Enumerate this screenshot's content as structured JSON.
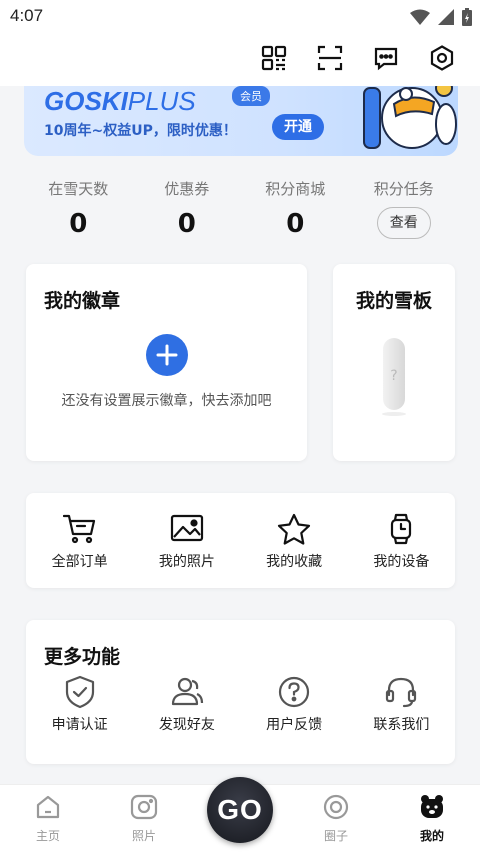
{
  "status_bar": {
    "time": "4:07"
  },
  "top_actions": [
    "qr-code-icon",
    "scan-icon",
    "message-icon",
    "settings-icon"
  ],
  "banner": {
    "brand": "GOSKI",
    "brand_plus": "PLUS",
    "vip_tag": "会员",
    "promo": "10周年~权益UP，限时优惠！",
    "open_label": "开通"
  },
  "stats": [
    {
      "label": "在雪天数",
      "value": "0"
    },
    {
      "label": "优惠券",
      "value": "0"
    },
    {
      "label": "积分商城",
      "value": "0"
    },
    {
      "label": "积分任务",
      "action": "查看"
    }
  ],
  "badges": {
    "title": "我的徽章",
    "hint": "还没有设置展示徽章，快去添加吧"
  },
  "board": {
    "title": "我的雪板"
  },
  "orders": [
    {
      "label": "全部订单",
      "icon": "cart-icon"
    },
    {
      "label": "我的照片",
      "icon": "photo-icon"
    },
    {
      "label": "我的收藏",
      "icon": "star-icon"
    },
    {
      "label": "我的设备",
      "icon": "watch-icon"
    }
  ],
  "more": {
    "title": "更多功能",
    "items": [
      {
        "label": "申请认证",
        "icon": "shield-check-icon"
      },
      {
        "label": "发现好友",
        "icon": "friends-icon"
      },
      {
        "label": "用户反馈",
        "icon": "feedback-icon"
      },
      {
        "label": "联系我们",
        "icon": "headset-icon"
      }
    ]
  },
  "bottom_nav": {
    "items": [
      {
        "label": "主页",
        "icon": "home-icon"
      },
      {
        "label": "照片",
        "icon": "camera-icon"
      },
      {
        "label": "圈子",
        "icon": "circle-icon"
      },
      {
        "label": "我的",
        "icon": "bear-icon",
        "active": true
      }
    ],
    "go_label": "GO"
  },
  "colors": {
    "accent": "#2f6fe3",
    "banner_bg": "#d3e4ff"
  }
}
